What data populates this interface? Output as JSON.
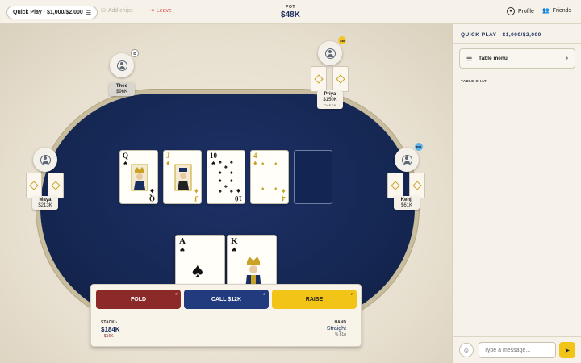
{
  "topbar": {
    "room": "Quick Play · $1,000/$2,000",
    "add_chips": "Add chips",
    "leave": "Leave",
    "pot_label": "POT",
    "pot_value": "$48K",
    "profile": "Profile",
    "friends": "Friends"
  },
  "players": {
    "theo": {
      "name": "Theo",
      "stack": "$96K",
      "badge": "D"
    },
    "priya": {
      "name": "Priya",
      "stack": "$150K",
      "action": "CHECK",
      "badge": "SB"
    },
    "maya": {
      "name": "Maya",
      "stack": "$213K"
    },
    "kenji": {
      "name": "Kenji",
      "stack": "$61K",
      "badge": "BB"
    }
  },
  "community_cards": [
    {
      "rank": "Q",
      "suit": "♠"
    },
    {
      "rank": "J",
      "suit": "♦"
    },
    {
      "rank": "10",
      "suit": "♠"
    },
    {
      "rank": "4",
      "suit": "♦"
    }
  ],
  "hero_cards": [
    {
      "rank": "A",
      "suit": "♠"
    },
    {
      "rank": "K",
      "suit": "♠"
    }
  ],
  "actions": {
    "fold": "FOLD",
    "fold_key": "F",
    "call": "CALL $12K",
    "call_key": "C",
    "raise": "RAISE",
    "raise_key": "R"
  },
  "stack": {
    "label": "STACK",
    "value": "$184K",
    "delta": "↓ $16K"
  },
  "hand": {
    "label": "HAND",
    "value": "Straight",
    "equity": "% 81n"
  },
  "sidebar": {
    "title": "QUICK PLAY · $1,000/$2,000",
    "table_menu": "Table menu",
    "chat_label": "TABLE CHAT",
    "message_placeholder": "Type a message..."
  },
  "colors": {
    "felt": "#142650",
    "accent_gold": "#f1c417",
    "fold_red": "#8c2a2a",
    "call_blue": "#223a7e"
  }
}
